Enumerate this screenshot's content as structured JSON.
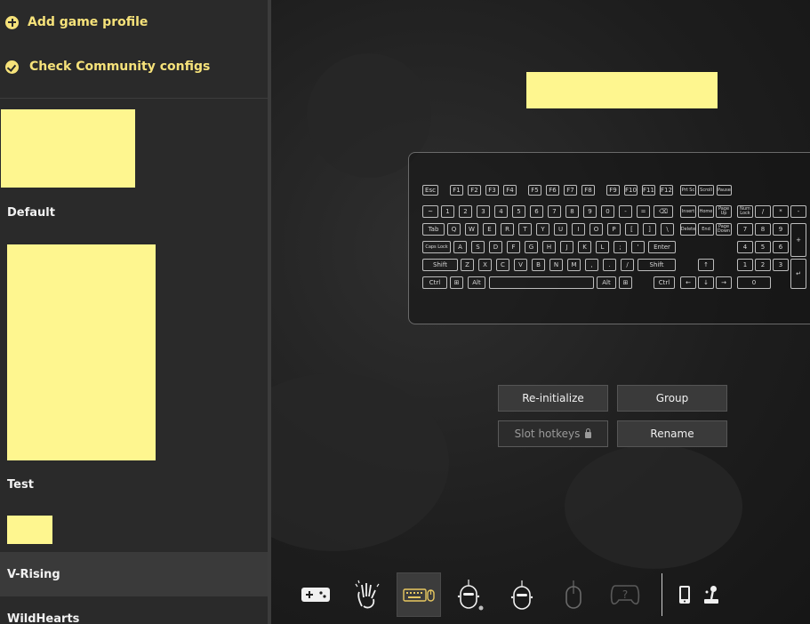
{
  "sidebar": {
    "actions": [
      {
        "label": "Add game profile",
        "icon": "plus-circle-icon"
      },
      {
        "label": "Check Community configs",
        "icon": "check-circle-icon"
      }
    ],
    "profiles": [
      {
        "name": "Default"
      },
      {
        "name": "Test"
      },
      {
        "name": "V-Rising",
        "selected": true
      },
      {
        "name": "WildHearts"
      }
    ]
  },
  "keyboard": {
    "row_fn": [
      "Esc",
      "F1",
      "F2",
      "F3",
      "F4",
      "F5",
      "F6",
      "F7",
      "F8",
      "F9",
      "F10",
      "F11",
      "F12",
      "Prt Sc",
      "Scroll",
      "Pause"
    ],
    "row_num": [
      "~",
      "1",
      "2",
      "3",
      "4",
      "5",
      "6",
      "7",
      "8",
      "9",
      "0",
      "-",
      "=",
      "⌫",
      "Insert",
      "Home",
      "Page Up",
      "Num Lock",
      "/",
      "*",
      "-"
    ],
    "row_tab": [
      "Tab",
      "Q",
      "W",
      "E",
      "R",
      "T",
      "Y",
      "U",
      "I",
      "O",
      "P",
      "[",
      "]",
      "\\",
      "Delete",
      "End",
      "Page Down",
      "7",
      "8",
      "9",
      "+"
    ],
    "row_caps": [
      "Caps Lock",
      "A",
      "S",
      "D",
      "F",
      "G",
      "H",
      "J",
      "K",
      "L",
      ";",
      "'",
      "Enter",
      "4",
      "5",
      "6"
    ],
    "row_shift": [
      "Shift",
      "Z",
      "X",
      "C",
      "V",
      "B",
      "N",
      "M",
      ",",
      ".",
      "/",
      "Shift",
      "↑",
      "1",
      "2",
      "3",
      "↵"
    ],
    "row_ctrl": [
      "Ctrl",
      "⊞",
      "Alt",
      "",
      "Alt",
      "⊞",
      "Ctrl",
      "←",
      "↓",
      "→",
      "0"
    ]
  },
  "buttons": {
    "reinitialize": "Re-initialize",
    "group": "Group",
    "slot_hotkeys": "Slot hotkeys",
    "rename": "Rename"
  },
  "toolbar": {
    "icons": [
      "gamepad-icon",
      "hand-gesture-icon",
      "keyboard-mouse-icon",
      "robot-mouse-icon",
      "robot-mouse-alt-icon",
      "mouse-icon",
      "unknown-controller-icon",
      "phone-icon",
      "joystick-icon"
    ]
  }
}
